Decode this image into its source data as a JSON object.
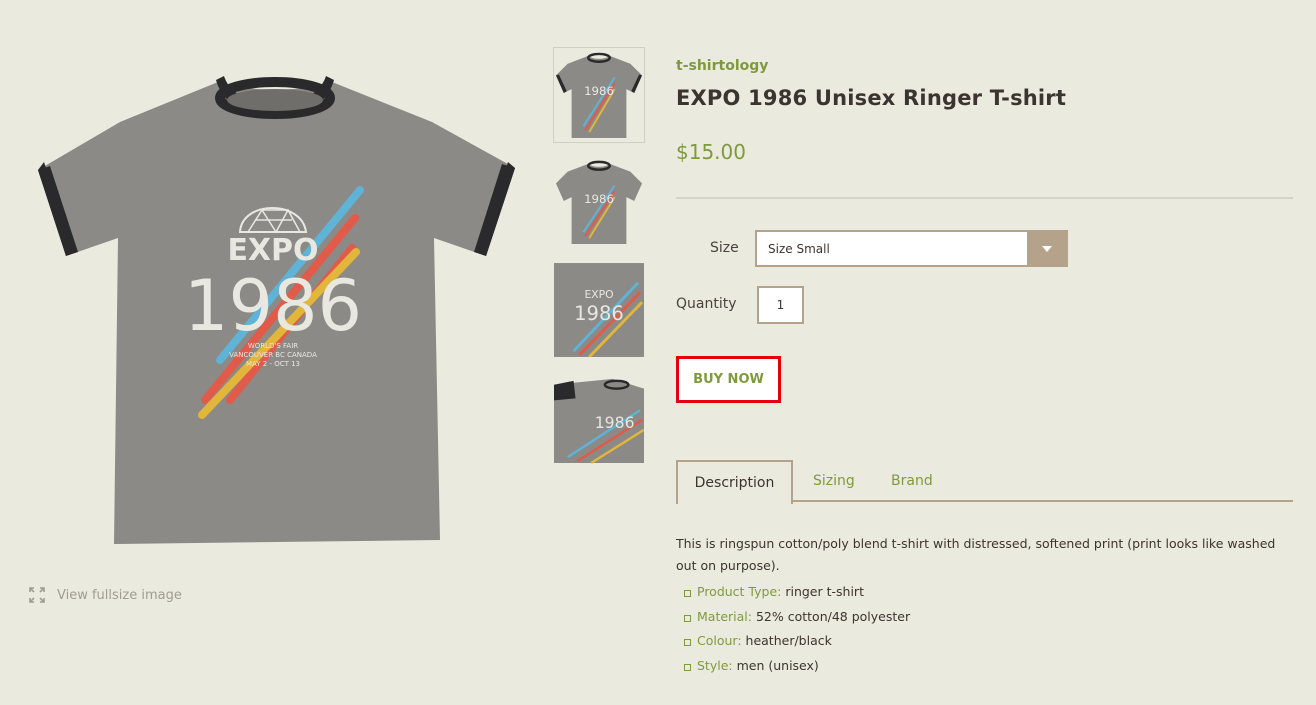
{
  "product": {
    "vendor": "t-shirtology",
    "title": "EXPO 1986 Unisex Ringer T-shirt",
    "price": "$15.00",
    "shirt_print": {
      "word": "EXPO",
      "year": "1986",
      "line1": "WORLD'S FAIR",
      "line2": "VANCOUVER BC CANADA",
      "line3": "MAY 2 - OCT 13"
    }
  },
  "gallery": {
    "view_fullsize_label": "View fullsize image",
    "thumbnails": [
      {
        "name": "thumbnail-front"
      },
      {
        "name": "thumbnail-front-alt"
      },
      {
        "name": "thumbnail-closeup"
      },
      {
        "name": "thumbnail-folded"
      }
    ]
  },
  "options": {
    "size_label": "Size",
    "size_value": "Size Small",
    "quantity_label": "Quantity",
    "quantity_value": "1"
  },
  "buy_now_label": "BUY NOW",
  "tabs": [
    {
      "label": "Description",
      "active": true
    },
    {
      "label": "Sizing",
      "active": false
    },
    {
      "label": "Brand",
      "active": false
    }
  ],
  "description": {
    "text": "This is ringspun cotton/poly blend t-shirt with distressed, softened print (print looks like washed out on purpose).",
    "items": [
      {
        "key": "Product Type:",
        "value": " ringer t-shirt"
      },
      {
        "key": "Material:",
        "value": " 52% cotton/48 polyester"
      },
      {
        "key": "Colour:",
        "value": " heather/black"
      },
      {
        "key": "Style:",
        "value": " men (unisex)"
      }
    ]
  },
  "colors": {
    "background": "#ebeadf",
    "accent_green": "#7f9a3d",
    "border_tan": "#b5a28a",
    "highlight_red": "#e4000f",
    "shirt_gray": "#8b8a86",
    "trim_black": "#2a2a2c"
  }
}
